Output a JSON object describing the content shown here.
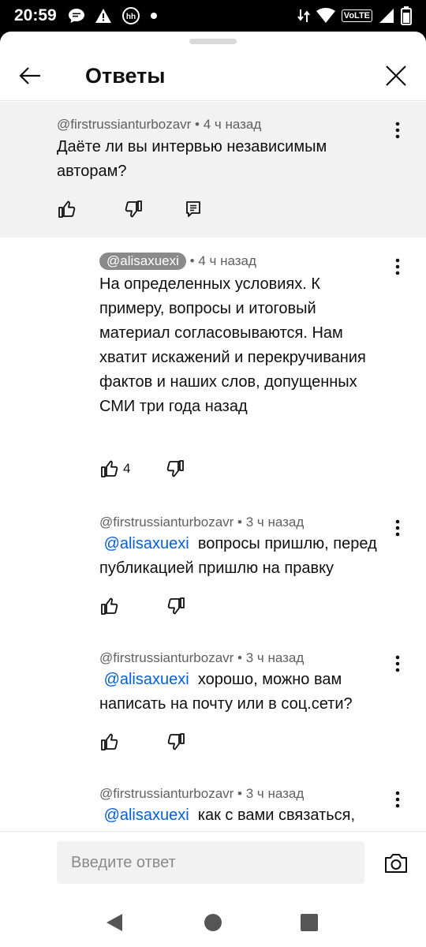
{
  "status_bar": {
    "time": "20:59",
    "icons_left": [
      "chat-bubble-icon",
      "warning-icon",
      "hh-icon",
      "dot-icon"
    ],
    "icons_right": [
      "data-arrows-icon",
      "wifi-icon",
      "volte-badge",
      "signal-icon",
      "battery-icon"
    ],
    "volte_label": "VoLTE"
  },
  "header": {
    "title": "Ответы"
  },
  "parent_comment": {
    "author": "@firstrussianturbozavr",
    "time": "• 4 ч назад",
    "text": "Даёте ли вы интервью независимым авторам?"
  },
  "replies": [
    {
      "author": "@alisaxuexi",
      "author_highlighted": true,
      "time": "• 4 ч назад",
      "text": "На определенных условиях. К примеру, вопросы и итоговый материал согласовываются. Нам хватит искажений и перекручивания фактов и наших слов, допущенных СМИ три года назад",
      "likes": "4"
    },
    {
      "author": "@firstrussianturbozavr",
      "time": "• 3 ч назад",
      "mention": "@alisaxuexi",
      "text": "вопросы пришлю, перед публикацией пришлю на правку"
    },
    {
      "author": "@firstrussianturbozavr",
      "time": "• 3 ч назад",
      "mention": "@alisaxuexi",
      "text": "хорошо, можно вам написать на почту или в соц.сети?"
    },
    {
      "author": "@firstrussianturbozavr",
      "time": "• 3 ч назад",
      "mention": "@alisaxuexi",
      "text": "как с вами связаться,"
    }
  ],
  "composer": {
    "placeholder": "Введите ответ"
  },
  "colors": {
    "mention": "#065fd4",
    "parent_bg": "#f2f2f2",
    "meta_text": "#606060",
    "author_chip_bg": "#8a8a8a"
  }
}
